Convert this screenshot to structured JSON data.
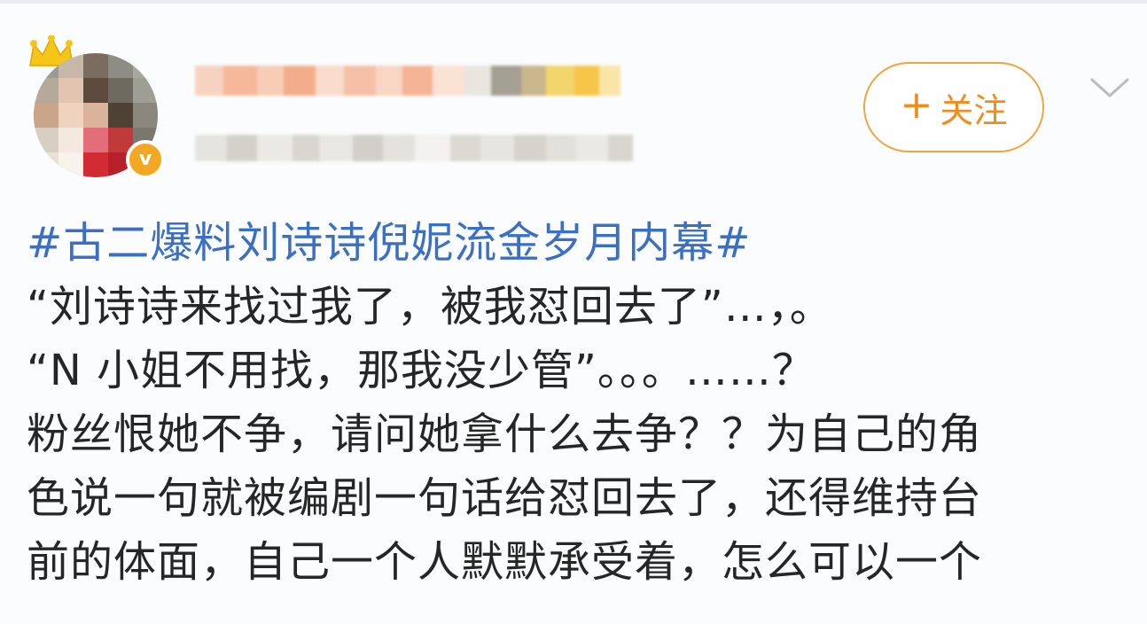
{
  "post": {
    "follow_button": {
      "icon": "plus-icon",
      "label": "关注"
    },
    "more_icon": "chevron-down-icon",
    "topic": "#古二爆料刘诗诗倪妮流金岁月内幕#",
    "lines": [
      "“刘诗诗来找过我了，被我怼回去了”…，。",
      "“N 小姐不用找，那我没少管”。。。……？",
      "粉丝恨她不争，请问她拿什么去争？？为自己的角",
      "色说一句就被编剧一句话给怼回去了，还得维持台",
      "前的体面，自己一个人默默承受着，怎么可以一个"
    ],
    "verified_badge": "v",
    "colors": {
      "accent": "#f08c1e",
      "topic_link": "#3b6fc4",
      "text": "#262626",
      "badge": "#f3a722"
    }
  }
}
